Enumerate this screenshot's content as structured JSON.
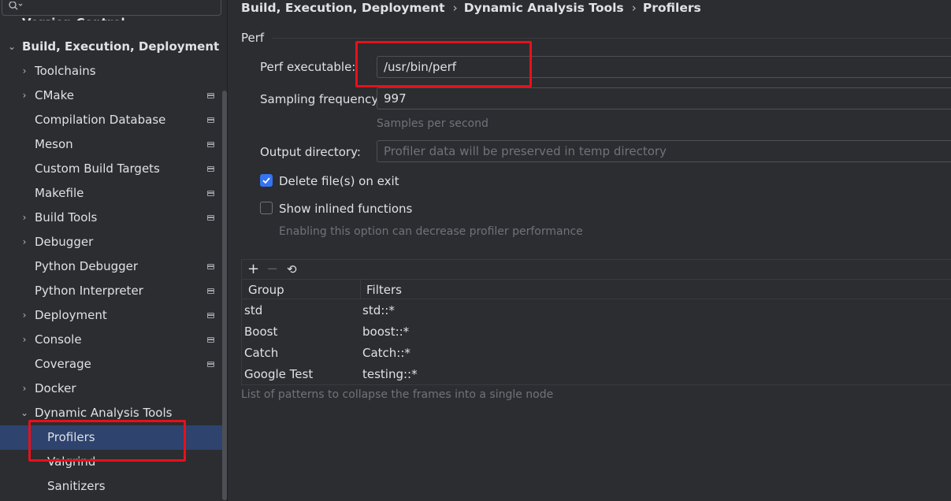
{
  "sidebar": {
    "search_placeholder": "",
    "partial_top_item": "Version Control",
    "items": [
      {
        "label": "Build, Execution, Deployment",
        "arrow": "⌄"
      },
      {
        "label": "Toolchains",
        "arrow": "›"
      },
      {
        "label": "CMake",
        "arrow": "›"
      },
      {
        "label": "Compilation Database",
        "arrow": ""
      },
      {
        "label": "Meson",
        "arrow": ""
      },
      {
        "label": "Custom Build Targets",
        "arrow": ""
      },
      {
        "label": "Makefile",
        "arrow": ""
      },
      {
        "label": "Build Tools",
        "arrow": "›"
      },
      {
        "label": "Debugger",
        "arrow": "›"
      },
      {
        "label": "Python Debugger",
        "arrow": ""
      },
      {
        "label": "Python Interpreter",
        "arrow": ""
      },
      {
        "label": "Deployment",
        "arrow": "›"
      },
      {
        "label": "Console",
        "arrow": "›"
      },
      {
        "label": "Coverage",
        "arrow": ""
      },
      {
        "label": "Docker",
        "arrow": "›"
      },
      {
        "label": "Dynamic Analysis Tools",
        "arrow": "⌄"
      },
      {
        "label": "Profilers",
        "arrow": ""
      },
      {
        "label": "Valgrind",
        "arrow": ""
      },
      {
        "label": "Sanitizers",
        "arrow": ""
      }
    ]
  },
  "breadcrumb": {
    "parts": [
      "Build, Execution, Deployment",
      "Dynamic Analysis Tools",
      "Profilers"
    ],
    "separator": "›"
  },
  "perf": {
    "section_title": "Perf",
    "executable_label": "Perf executable:",
    "executable_value": "/usr/bin/perf",
    "frequency_label": "Sampling frequency:",
    "frequency_value": "997",
    "frequency_hint": "Samples per second",
    "output_label": "Output directory:",
    "output_placeholder": "Profiler data will be preserved in temp directory",
    "delete_label": "Delete file(s) on exit",
    "delete_checked": true,
    "inline_label": "Show inlined functions",
    "inline_checked": false,
    "inline_hint": "Enabling this option can decrease profiler performance"
  },
  "filters_table": {
    "toolbar": {
      "add": "+",
      "remove": "−",
      "reset": "⟲"
    },
    "columns": [
      "Group",
      "Filters"
    ],
    "rows": [
      {
        "group": "std",
        "filter": "std::*"
      },
      {
        "group": "Boost",
        "filter": "boost::*"
      },
      {
        "group": "Catch",
        "filter": "Catch::*"
      },
      {
        "group": "Google Test",
        "filter": "testing::*"
      }
    ],
    "hint": "List of patterns to collapse the frames into a single node"
  },
  "colors": {
    "background": "#2b2d30",
    "selection": "#2e436e",
    "checkbox_accent": "#3574f0",
    "highlight_box": "#e8101a"
  }
}
